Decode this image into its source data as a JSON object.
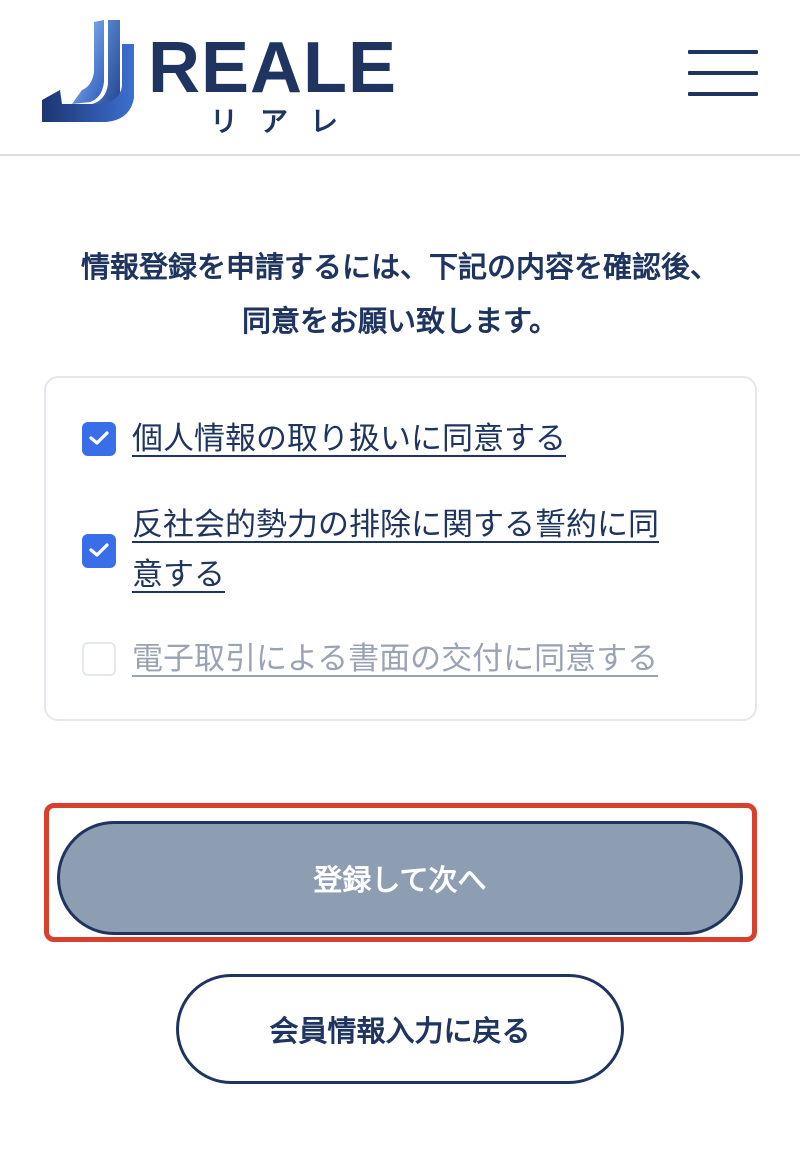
{
  "header": {
    "logo_text": "REALE",
    "logo_subtext": "リアレ",
    "menu_icon": "hamburger-menu-icon"
  },
  "intro": {
    "line1": "情報登録を申請するには、下記の内容を確認後、",
    "line2": "同意をお願い致します。"
  },
  "consents": [
    {
      "line1": "個人情報の取り扱いに同意する",
      "line2": "",
      "checked": true,
      "enabled": true
    },
    {
      "line1": "反社会的勢力の排除に関する誓約に同",
      "line2": "意する",
      "checked": true,
      "enabled": true
    },
    {
      "line1": "電子取引による書面の交付に同意する",
      "line2": "",
      "checked": false,
      "enabled": false
    }
  ],
  "buttons": {
    "next_label": "登録して次へ",
    "back_label": "会員情報入力に戻る"
  },
  "colors": {
    "brand": "#1f3560",
    "checkbox_checked": "#3a6ee8",
    "next_button_bg": "#8d9db2",
    "highlight": "#d8402e"
  }
}
